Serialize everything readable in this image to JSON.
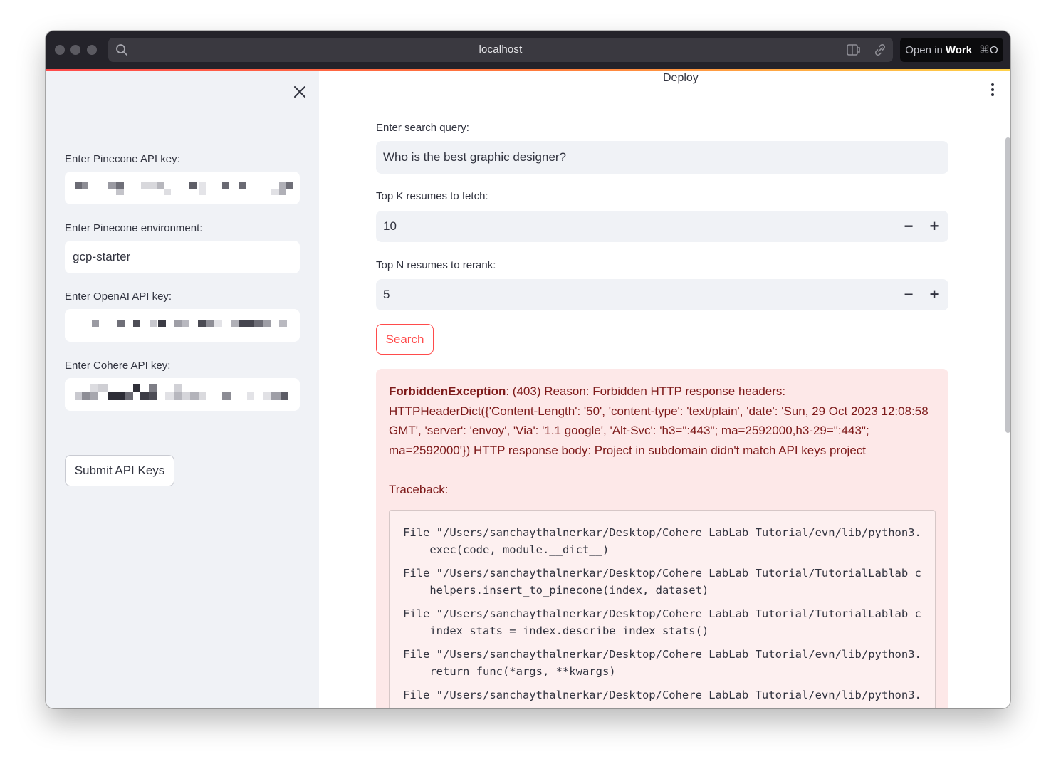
{
  "browser": {
    "url": "localhost",
    "open_in_prefix": "Open in",
    "open_in_target": "Work",
    "open_in_shortcut": "⌘O"
  },
  "sidebar": {
    "pinecone_key_label": "Enter Pinecone API key:",
    "pinecone_env_label": "Enter Pinecone environment:",
    "pinecone_env_value": "gcp-starter",
    "openai_key_label": "Enter OpenAI API key:",
    "cohere_key_label": "Enter Cohere API key:",
    "submit_label": "Submit API Keys"
  },
  "header": {
    "deploy_label": "Deploy"
  },
  "main": {
    "query_label": "Enter search query:",
    "query_value": "Who is the best graphic designer?",
    "topk_label": "Top K resumes to fetch:",
    "topk_value": "10",
    "topn_label": "Top N resumes to rerank:",
    "topn_value": "5",
    "minus_symbol": "−",
    "plus_symbol": "+",
    "search_label": "Search"
  },
  "error": {
    "exception_name": "ForbiddenException",
    "message": ": (403) Reason: Forbidden HTTP response headers: HTTPHeaderDict({'Content-Length': '50', 'content-type': 'text/plain', 'date': 'Sun, 29 Oct 2023 12:08:58 GMT', 'server': 'envoy', 'Via': '1.1 google', 'Alt-Svc': 'h3=\":443\"; ma=2592000,h3-29=\":443\"; ma=2592000'}) HTTP response body: Project in subdomain didn't match API keys project",
    "traceback_label": "Traceback:",
    "traceback_lines": [
      "File \"/Users/sanchaythalnerkar/Desktop/Cohere LabLab Tutorial/evn/lib/python3.",
      "    exec(code, module.__dict__)",
      "File \"/Users/sanchaythalnerkar/Desktop/Cohere LabLab Tutorial/TutorialLablab c",
      "    helpers.insert_to_pinecone(index, dataset)",
      "File \"/Users/sanchaythalnerkar/Desktop/Cohere LabLab Tutorial/TutorialLablab c",
      "    index_stats = index.describe_index_stats()",
      "File \"/Users/sanchaythalnerkar/Desktop/Cohere LabLab Tutorial/evn/lib/python3.",
      "    return func(*args, **kwargs)",
      "File \"/Users/sanchaythalnerkar/Desktop/Cohere LabLab Tutorial/evn/lib/python3."
    ]
  },
  "colors": {
    "accent": "#ff4b4b",
    "sidebar_bg": "#f0f2f6",
    "error_bg": "#fde8e8",
    "error_text": "#7d1a1a"
  },
  "icons": [
    "search-icon",
    "reader-mode-icon",
    "link-icon",
    "close-icon",
    "kebab-menu-icon",
    "minus-icon",
    "plus-icon"
  ]
}
